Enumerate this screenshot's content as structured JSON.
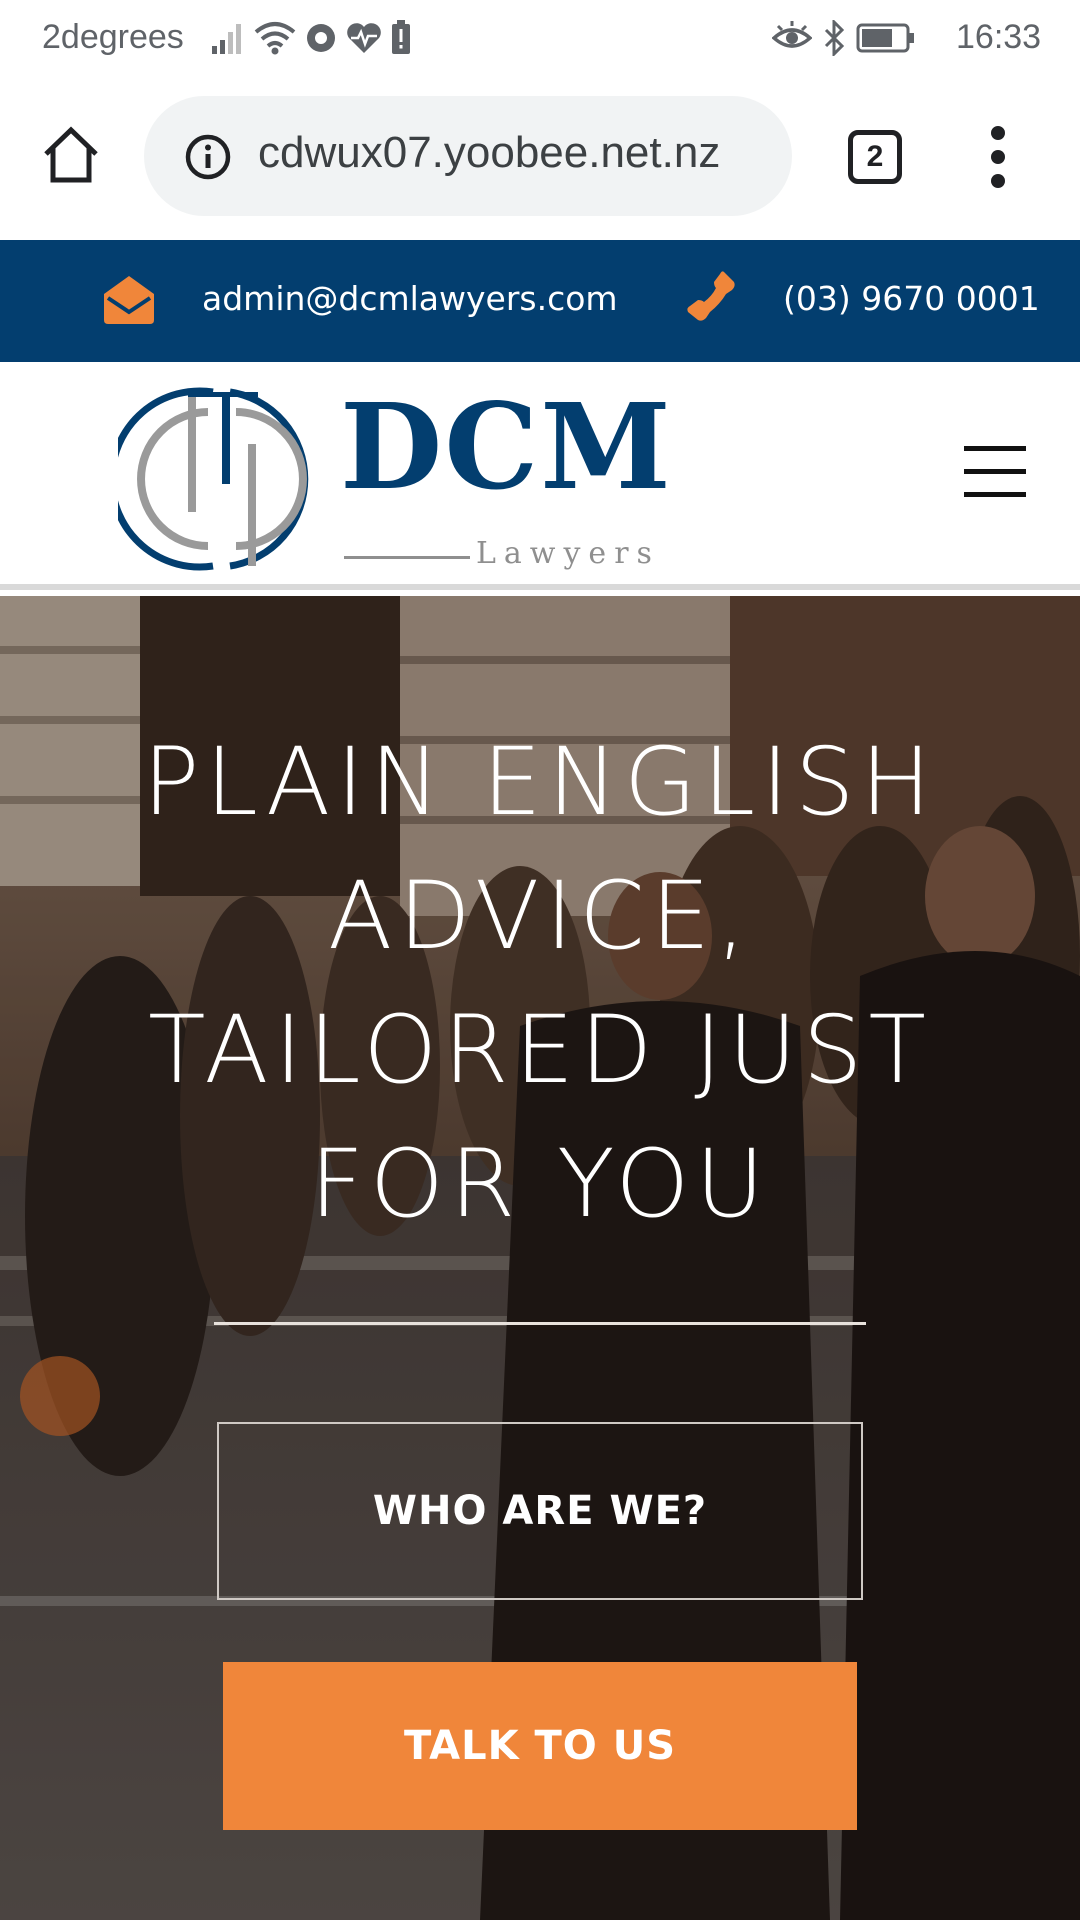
{
  "status_bar": {
    "carrier": "2degrees",
    "time": "16:33",
    "left_icons": [
      "signal-icon",
      "wifi-icon",
      "record-icon",
      "heart-rate-icon",
      "battery-alert-icon"
    ],
    "right_icons": [
      "eye-icon",
      "bluetooth-icon",
      "battery-icon"
    ]
  },
  "browser": {
    "url": "cdwux07.yoobee.net.nz",
    "tab_count": "2"
  },
  "contact_bar": {
    "email": "admin@dcmlawyers.com",
    "phone": "(03) 9670 0001",
    "background_color": "#033e6f",
    "accent_color": "#f0863a"
  },
  "header": {
    "logo_title": "DCM",
    "logo_subtitle": "Lawyers"
  },
  "hero": {
    "title_lines": [
      "PLAIN ENGLISH",
      "ADVICE,",
      "TAILORED JUST",
      "FOR YOU"
    ],
    "secondary_button": "WHO ARE WE?",
    "primary_button": "TALK TO US",
    "primary_button_color": "#f0863a"
  }
}
